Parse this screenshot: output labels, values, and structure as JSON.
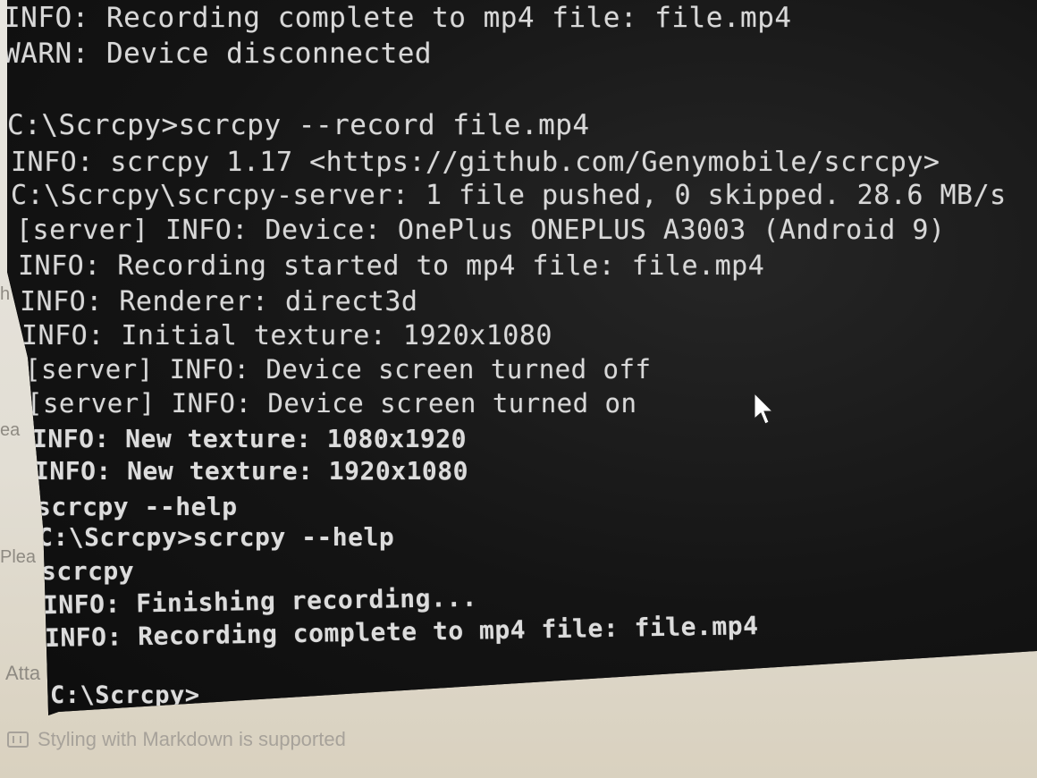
{
  "terminal": {
    "lines": [
      "INFO: Recording complete to mp4 file: file.mp4",
      "WARN: Device disconnected",
      "",
      "C:\\Scrcpy>scrcpy --record file.mp4",
      "INFO: scrcpy 1.17 <https://github.com/Genymobile/scrcpy>",
      "C:\\Scrcpy\\scrcpy-server: 1 file pushed, 0 skipped. 28.6 MB/s",
      "[server] INFO: Device: OnePlus ONEPLUS A3003 (Android 9)",
      "INFO: Recording started to mp4 file: file.mp4",
      "INFO: Renderer: direct3d",
      "INFO: Initial texture: 1920x1080",
      "[server] INFO: Device screen turned off",
      "[server] INFO: Device screen turned on",
      "INFO: New texture: 1080x1920",
      "INFO: New texture: 1920x1080",
      "scrcpy --help",
      "C:\\Scrcpy>scrcpy --help",
      "scrcpy",
      "INFO: Finishing recording...",
      "INFO: Recording complete to mp4 file: file.mp4",
      "",
      "C:\\Scrcpy>"
    ]
  },
  "background": {
    "fragments": [
      "h",
      "ea",
      "Plea",
      "Atta"
    ],
    "markdown_note": "Styling with Markdown is supported",
    "markdown_icon": "markdown-icon"
  },
  "cursor": {
    "icon": "mouse-pointer-icon",
    "color": "#ffffff"
  }
}
